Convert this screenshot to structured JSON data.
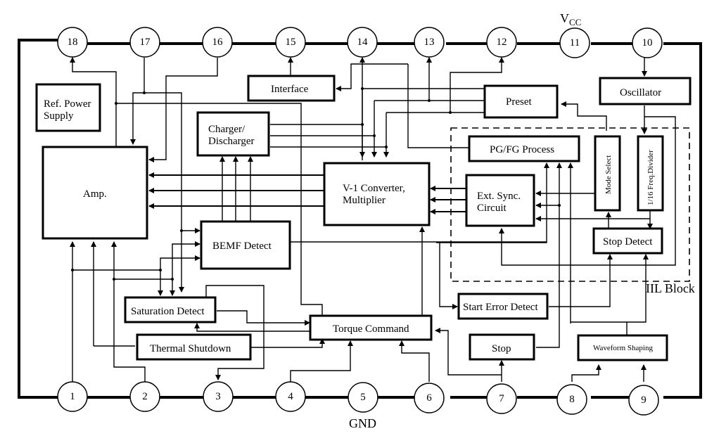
{
  "diagram": {
    "top_pins": [
      "18",
      "17",
      "16",
      "15",
      "14",
      "13",
      "12",
      "11",
      "10"
    ],
    "bottom_pins": [
      "1",
      "2",
      "3",
      "4",
      "5",
      "6",
      "7",
      "8",
      "9"
    ],
    "labels": {
      "vcc_main": "V",
      "vcc_sub": "CC",
      "gnd": "GND",
      "iil_block": "IIL Block"
    },
    "blocks": {
      "ref_power_supply": [
        "Ref. Power",
        "Supply"
      ],
      "amp": "Amp.",
      "charger_discharger": [
        "Charger/",
        "Discharger"
      ],
      "interface": "Interface",
      "preset": "Preset",
      "oscillator": "Oscillator",
      "pg_fg_process": "PG/FG Process",
      "mode_select": "Mode Select",
      "freq_divider": "1/16 Freq.Divider",
      "ext_sync_circuit": [
        "Ext. Sync.",
        "Circuit"
      ],
      "v1_converter": [
        "V-1 Converter,",
        "Multiplier"
      ],
      "bemf_detect": "BEMF Detect",
      "stop_detect": "Stop Detect",
      "saturation_detect": "Saturation Detect",
      "thermal_shutdown": "Thermal Shutdown",
      "torque_command": "Torque Command",
      "start_error_detect": "Start Error Detect",
      "stop": "Stop",
      "waveform_shaping": "Waveform Shaping"
    }
  }
}
